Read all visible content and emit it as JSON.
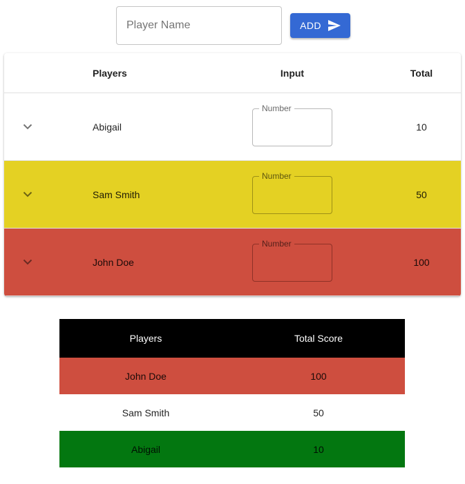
{
  "add_bar": {
    "player_name_placeholder": "Player Name",
    "player_name_value": "",
    "add_label": "ADD",
    "add_icon": "send-icon",
    "accent_color": "#3469d4"
  },
  "main_table": {
    "headers": {
      "players": "Players",
      "input": "Input",
      "total": "Total"
    },
    "rows": [
      {
        "player": "Abigail",
        "input_label": "Number",
        "input_value": "",
        "total": "10",
        "color": "#ffffff"
      },
      {
        "player": "Sam Smith",
        "input_label": "Number",
        "input_value": "",
        "total": "50",
        "color": "#e4d123"
      },
      {
        "player": "John Doe",
        "input_label": "Number",
        "input_value": "",
        "total": "100",
        "color": "#ce4e3f"
      }
    ],
    "expand_icon": "chevron-down-icon"
  },
  "score_table": {
    "headers": {
      "players": "Players",
      "total_score": "Total Score"
    },
    "header_color": "#000000",
    "rows": [
      {
        "player": "John Doe",
        "score": "100",
        "color": "#ce4e3f"
      },
      {
        "player": "Sam Smith",
        "score": "50",
        "color": "#ffffff"
      },
      {
        "player": "Abigail",
        "score": "10",
        "color": "#037710"
      }
    ]
  }
}
